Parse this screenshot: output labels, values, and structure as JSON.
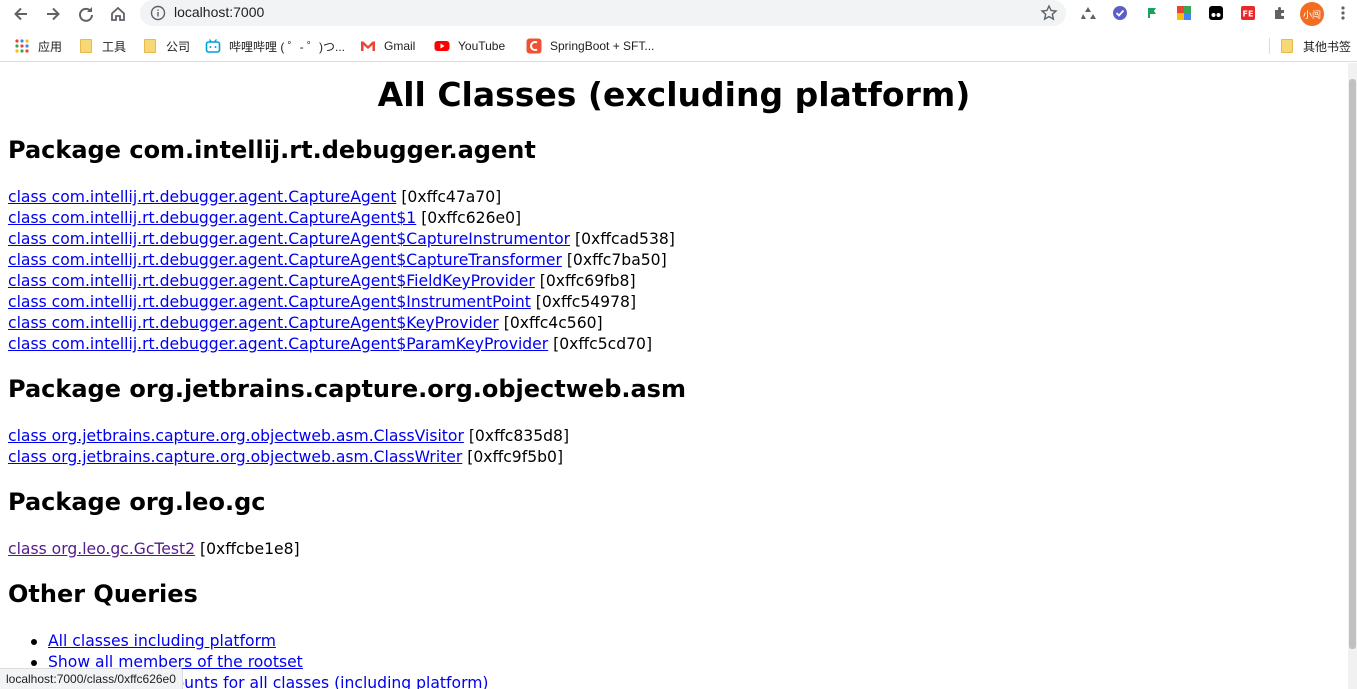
{
  "browser": {
    "url": "localhost:7000",
    "bookmarks": [
      {
        "label": "应用",
        "icon": "apps-grid-icon"
      },
      {
        "label": "工具",
        "icon": "folder-icon"
      },
      {
        "label": "公司",
        "icon": "folder-icon"
      },
      {
        "label": "哔哩哔哩 ( ゜- ゜)つ...",
        "icon": "bilibili-icon"
      },
      {
        "label": "Gmail",
        "icon": "gmail-icon"
      },
      {
        "label": "YouTube",
        "icon": "youtube-icon"
      },
      {
        "label": "SpringBoot + SFT...",
        "icon": "sft-icon"
      }
    ],
    "other_bookmarks": "其他书签",
    "profile_label": "小闯",
    "status_url": "localhost:7000/class/0xffc626e0"
  },
  "page": {
    "title": "All Classes (excluding platform)",
    "packages": [
      {
        "heading": "Package com.intellij.rt.debugger.agent",
        "classes": [
          {
            "name": "class com.intellij.rt.debugger.agent.CaptureAgent",
            "addr": " [0xffc47a70]"
          },
          {
            "name": "class com.intellij.rt.debugger.agent.CaptureAgent$1",
            "addr": " [0xffc626e0]"
          },
          {
            "name": "class com.intellij.rt.debugger.agent.CaptureAgent$CaptureInstrumentor",
            "addr": " [0xffcad538]"
          },
          {
            "name": "class com.intellij.rt.debugger.agent.CaptureAgent$CaptureTransformer",
            "addr": " [0xffc7ba50]"
          },
          {
            "name": "class com.intellij.rt.debugger.agent.CaptureAgent$FieldKeyProvider",
            "addr": " [0xffc69fb8]"
          },
          {
            "name": "class com.intellij.rt.debugger.agent.CaptureAgent$InstrumentPoint",
            "addr": " [0xffc54978]"
          },
          {
            "name": "class com.intellij.rt.debugger.agent.CaptureAgent$KeyProvider",
            "addr": " [0xffc4c560]"
          },
          {
            "name": "class com.intellij.rt.debugger.agent.CaptureAgent$ParamKeyProvider",
            "addr": " [0xffc5cd70]"
          }
        ]
      },
      {
        "heading": "Package org.jetbrains.capture.org.objectweb.asm",
        "classes": [
          {
            "name": "class org.jetbrains.capture.org.objectweb.asm.ClassVisitor",
            "addr": " [0xffc835d8]"
          },
          {
            "name": "class org.jetbrains.capture.org.objectweb.asm.ClassWriter",
            "addr": " [0xffc9f5b0]"
          }
        ]
      },
      {
        "heading": "Package org.leo.gc",
        "classes": [
          {
            "name": "class org.leo.gc.GcTest2",
            "addr": " [0xffcbe1e8]",
            "visited": true
          }
        ]
      }
    ],
    "other_queries_heading": "Other Queries",
    "other_queries": [
      "All classes including platform",
      "Show all members of the rootset",
      "Show instance counts for all classes (including platform)"
    ]
  },
  "colors": {
    "link": "#0000ee",
    "visited_link": "#551a8b",
    "chrome_bg": "#f1f3f4"
  }
}
